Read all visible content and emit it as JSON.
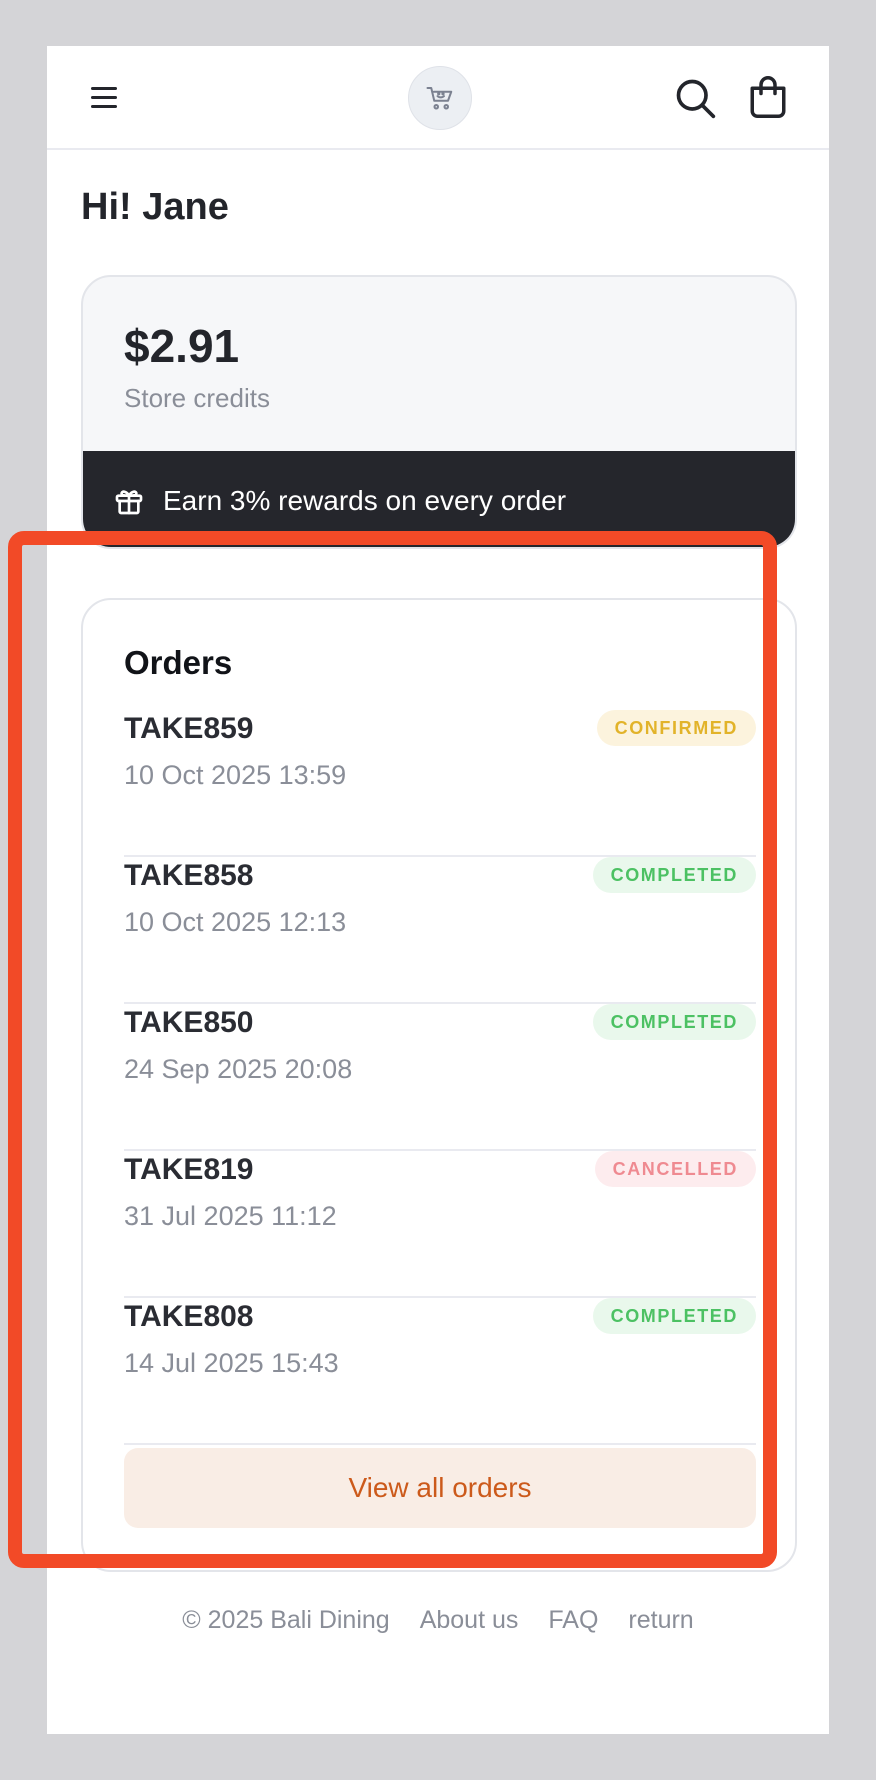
{
  "header": {
    "menu_icon": "hamburger-menu-icon",
    "logo_icon": "cart-logo-icon",
    "search_icon": "search-icon",
    "bag_icon": "shopping-bag-icon"
  },
  "greeting": "Hi! Jane",
  "credits": {
    "amount": "$2.91",
    "label": "Store credits",
    "rewards_text": "Earn 3% rewards on every order",
    "rewards_icon": "gift-icon"
  },
  "orders": {
    "title": "Orders",
    "items": [
      {
        "id": "TAKE859",
        "date": "10 Oct 2025 13:59",
        "status": "CONFIRMED"
      },
      {
        "id": "TAKE858",
        "date": "10 Oct 2025 12:13",
        "status": "COMPLETED"
      },
      {
        "id": "TAKE850",
        "date": "24 Sep 2025 20:08",
        "status": "COMPLETED"
      },
      {
        "id": "TAKE819",
        "date": "31 Jul 2025 11:12",
        "status": "CANCELLED"
      },
      {
        "id": "TAKE808",
        "date": "14 Jul 2025 15:43",
        "status": "COMPLETED"
      }
    ],
    "view_all_label": "View all orders"
  },
  "footer": {
    "copyright": "© 2025 Bali Dining",
    "about": "About us",
    "faq": "FAQ",
    "return": "return"
  },
  "colors": {
    "highlight": "#f24a27",
    "confirmed": "#e2b32a",
    "completed": "#4cc163",
    "cancelled": "#ef8a91",
    "accent": "#cc5a1b"
  }
}
